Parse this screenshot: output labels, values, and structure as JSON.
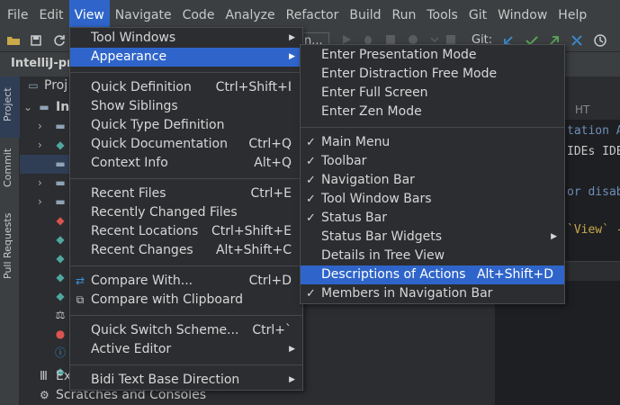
{
  "menubar": {
    "items": [
      "File",
      "Edit",
      "View",
      "Navigate",
      "Code",
      "Analyze",
      "Refactor",
      "Build",
      "Run",
      "Tools",
      "Git",
      "Window",
      "Help"
    ],
    "active_index": 2
  },
  "toolbar": {
    "git_label": "Git:",
    "run_config_fragment": "n..."
  },
  "project_header": {
    "title": "IntelliJ-pr"
  },
  "side_stripe": {
    "project": "Project",
    "commit": "Commit",
    "pull_requests": "Pull Requests"
  },
  "tree": {
    "root_fragment": "Proj",
    "child_fragment": "Int",
    "bottom_ex": "Ex",
    "scratches": "Scratches and Consoles"
  },
  "editor": {
    "tab_fragment": "HT",
    "line1": "tation As",
    "line2": "IDEs IDE",
    "line3": "or disab",
    "line4": "`View` -"
  },
  "view_menu": {
    "items": [
      {
        "label": "Tool Windows",
        "shortcut": "",
        "submenu": true
      },
      {
        "label": "Appearance",
        "shortcut": "",
        "submenu": true
      },
      {
        "label": "Quick Definition",
        "shortcut": "Ctrl+Shift+I",
        "submenu": false
      },
      {
        "label": "Show Siblings",
        "shortcut": "",
        "submenu": false
      },
      {
        "label": "Quick Type Definition",
        "shortcut": "",
        "submenu": false
      },
      {
        "label": "Quick Documentation",
        "shortcut": "Ctrl+Q",
        "submenu": false
      },
      {
        "label": "Context Info",
        "shortcut": "Alt+Q",
        "submenu": false
      },
      {
        "label": "Recent Files",
        "shortcut": "Ctrl+E",
        "submenu": false
      },
      {
        "label": "Recently Changed Files",
        "shortcut": "",
        "submenu": false
      },
      {
        "label": "Recent Locations",
        "shortcut": "Ctrl+Shift+E",
        "submenu": false
      },
      {
        "label": "Recent Changes",
        "shortcut": "Alt+Shift+C",
        "submenu": false
      },
      {
        "label": "Compare With...",
        "shortcut": "Ctrl+D",
        "submenu": false
      },
      {
        "label": "Compare with Clipboard",
        "shortcut": "",
        "submenu": false
      },
      {
        "label": "Quick Switch Scheme...",
        "shortcut": "Ctrl+`",
        "submenu": false
      },
      {
        "label": "Active Editor",
        "shortcut": "",
        "submenu": true
      },
      {
        "label": "Bidi Text Base Direction",
        "shortcut": "",
        "submenu": true
      }
    ]
  },
  "appearance_menu": {
    "items": [
      {
        "label": "Enter Presentation Mode",
        "checked": false,
        "shortcut": ""
      },
      {
        "label": "Enter Distraction Free Mode",
        "checked": false,
        "shortcut": ""
      },
      {
        "label": "Enter Full Screen",
        "checked": false,
        "shortcut": ""
      },
      {
        "label": "Enter Zen Mode",
        "checked": false,
        "shortcut": ""
      },
      {
        "label": "Main Menu",
        "checked": true,
        "shortcut": ""
      },
      {
        "label": "Toolbar",
        "checked": true,
        "shortcut": ""
      },
      {
        "label": "Navigation Bar",
        "checked": true,
        "shortcut": ""
      },
      {
        "label": "Tool Window Bars",
        "checked": true,
        "shortcut": ""
      },
      {
        "label": "Status Bar",
        "checked": true,
        "shortcut": ""
      },
      {
        "label": "Status Bar Widgets",
        "checked": false,
        "shortcut": "",
        "submenu": true
      },
      {
        "label": "Details in Tree View",
        "checked": false,
        "shortcut": ""
      },
      {
        "label": "Descriptions of Actions",
        "checked": false,
        "shortcut": "Alt+Shift+D"
      },
      {
        "label": "Members in Navigation Bar",
        "checked": true,
        "shortcut": ""
      }
    ]
  },
  "colors": {
    "accent": "#2f65ca",
    "menu_bg": "#2b2d30",
    "chrome_bg": "#3c3f41",
    "editor_bg": "#1e1f22"
  }
}
